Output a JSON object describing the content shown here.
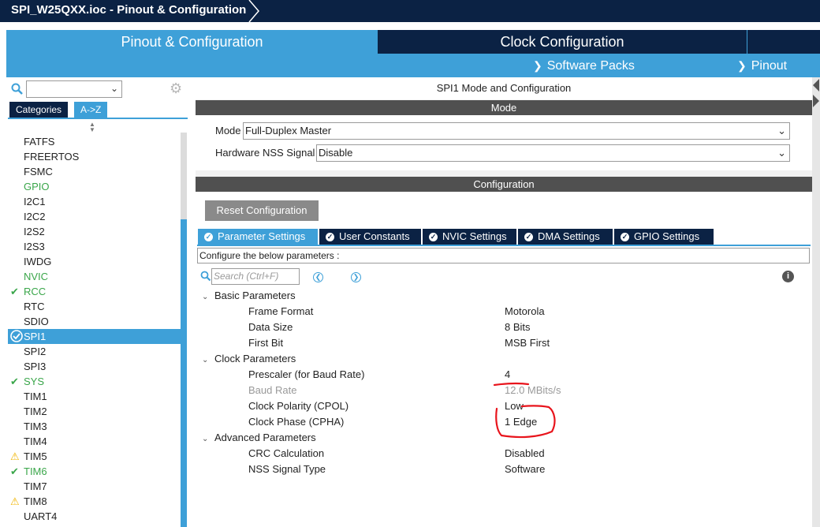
{
  "window": {
    "title": "SPI_W25QXX.ioc - Pinout & Configuration"
  },
  "main_tabs": {
    "pinout_config": "Pinout & Configuration",
    "clock_config": "Clock Configuration"
  },
  "sub_tabs": {
    "software_packs": "Software Packs",
    "pinout": "Pinout"
  },
  "left_panel": {
    "search_value": "",
    "tabs": {
      "categories": "Categories",
      "az": "A->Z"
    },
    "items": [
      {
        "label": "FATFS",
        "status": "none"
      },
      {
        "label": "FREERTOS",
        "status": "none"
      },
      {
        "label": "FSMC",
        "status": "none"
      },
      {
        "label": "GPIO",
        "status": "green"
      },
      {
        "label": "I2C1",
        "status": "none"
      },
      {
        "label": "I2C2",
        "status": "none"
      },
      {
        "label": "I2S2",
        "status": "none"
      },
      {
        "label": "I2S3",
        "status": "none"
      },
      {
        "label": "IWDG",
        "status": "none"
      },
      {
        "label": "NVIC",
        "status": "green"
      },
      {
        "label": "RCC",
        "status": "check"
      },
      {
        "label": "RTC",
        "status": "none"
      },
      {
        "label": "SDIO",
        "status": "none"
      },
      {
        "label": "SPI1",
        "status": "selected"
      },
      {
        "label": "SPI2",
        "status": "none"
      },
      {
        "label": "SPI3",
        "status": "none"
      },
      {
        "label": "SYS",
        "status": "check"
      },
      {
        "label": "TIM1",
        "status": "none"
      },
      {
        "label": "TIM2",
        "status": "none"
      },
      {
        "label": "TIM3",
        "status": "none"
      },
      {
        "label": "TIM4",
        "status": "none"
      },
      {
        "label": "TIM5",
        "status": "warning"
      },
      {
        "label": "TIM6",
        "status": "check"
      },
      {
        "label": "TIM7",
        "status": "none"
      },
      {
        "label": "TIM8",
        "status": "warning"
      },
      {
        "label": "UART4",
        "status": "none"
      }
    ]
  },
  "right_panel": {
    "title": "SPI1 Mode and Configuration",
    "mode_header": "Mode",
    "mode_label": "Mode",
    "mode_value": "Full-Duplex Master",
    "nss_label": "Hardware NSS Signal",
    "nss_value": "Disable",
    "config_header": "Configuration",
    "reset_button": "Reset Configuration",
    "tabs": {
      "parameter_settings": "Parameter Settings",
      "user_constants": "User Constants",
      "nvic_settings": "NVIC Settings",
      "dma_settings": "DMA Settings",
      "gpio_settings": "GPIO Settings"
    },
    "configure_text": "Configure the below parameters :",
    "search_placeholder": "Search (Ctrl+F)",
    "groups": {
      "basic": {
        "label": "Basic Parameters",
        "params": [
          {
            "name": "Frame Format",
            "value": "Motorola"
          },
          {
            "name": "Data Size",
            "value": "8 Bits"
          },
          {
            "name": "First Bit",
            "value": "MSB First"
          }
        ]
      },
      "clock": {
        "label": "Clock Parameters",
        "params": [
          {
            "name": "Prescaler (for Baud Rate)",
            "value": "4"
          },
          {
            "name": "Baud Rate",
            "value": "12.0 MBits/s"
          },
          {
            "name": "Clock Polarity (CPOL)",
            "value": "Low"
          },
          {
            "name": "Clock Phase (CPHA)",
            "value": "1 Edge"
          }
        ]
      },
      "advanced": {
        "label": "Advanced Parameters",
        "params": [
          {
            "name": "CRC Calculation",
            "value": "Disabled"
          },
          {
            "name": "NSS Signal Type",
            "value": "Software"
          }
        ]
      }
    }
  },
  "colors": {
    "accent_blue": "#3ea0d8",
    "dark_navy": "#0b2244",
    "status_green": "#3aa64a",
    "warning_yellow": "#f0b400",
    "annotation_red": "#e8141c"
  }
}
